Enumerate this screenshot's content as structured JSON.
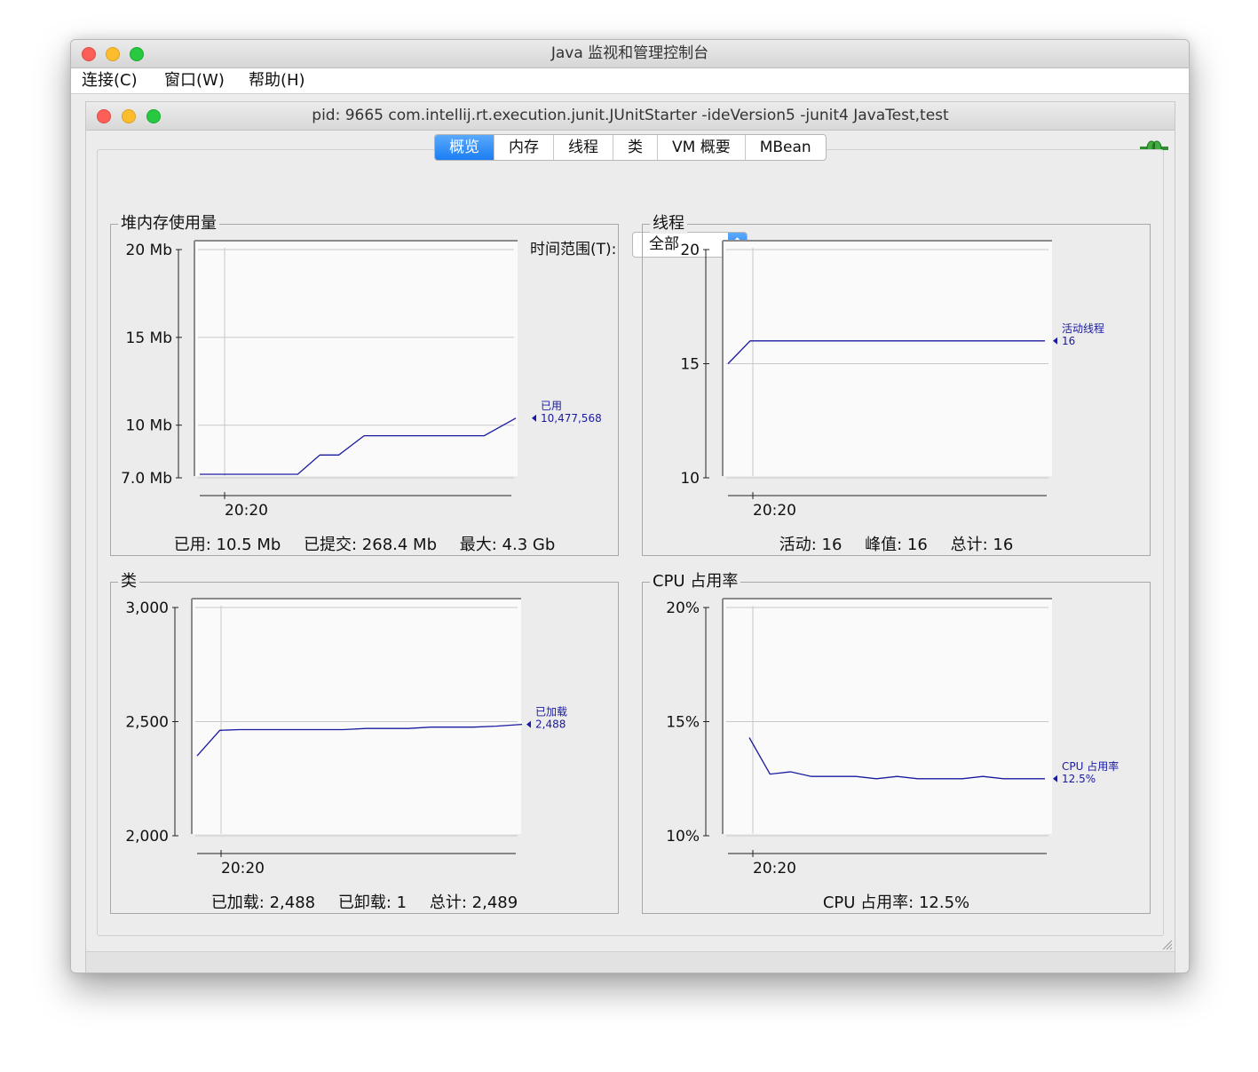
{
  "outer_window": {
    "title": "Java 监视和管理控制台"
  },
  "menu": [
    "连接(C)",
    "窗口(W)",
    "帮助(H)"
  ],
  "inner_window": {
    "title": "pid: 9665 com.intellij.rt.execution.junit.JUnitStarter -ideVersion5 -junit4 JavaTest,test"
  },
  "tabs": [
    {
      "label": "概览",
      "active": true
    },
    {
      "label": "内存",
      "active": false
    },
    {
      "label": "线程",
      "active": false
    },
    {
      "label": "类",
      "active": false
    },
    {
      "label": "VM 概要",
      "active": false
    },
    {
      "label": "MBean",
      "active": false
    }
  ],
  "time_range": {
    "label": "时间范围(T):",
    "value": "全部"
  },
  "icons": {
    "connection": "plug-connected-icon"
  },
  "colors": {
    "series": "#1a1aa0",
    "accent": "#1b7ef3"
  },
  "panels": {
    "heap": {
      "title": "堆内存使用量",
      "summary": [
        "已用: 10.5 Mb",
        "已提交: 268.4 Mb",
        "最大: 4.3 Gb"
      ],
      "chart_data": {
        "type": "line",
        "yticks": [
          {
            "label": "20 Mb",
            "value": 20
          },
          {
            "label": "15 Mb",
            "value": 15
          },
          {
            "label": "10 Mb",
            "value": 10
          },
          {
            "label": "7.0 Mb",
            "value": 7
          }
        ],
        "ylim": [
          7,
          20
        ],
        "xtick": "20:20",
        "series": [
          {
            "name": "已用",
            "value_label": "10,477,568",
            "x": [
              0,
              0.31,
              0.38,
              0.44,
              0.52,
              0.9,
              1.0
            ],
            "y": [
              7.2,
              7.2,
              8.3,
              8.3,
              9.4,
              9.4,
              10.4
            ]
          }
        ]
      }
    },
    "threads": {
      "title": "线程",
      "summary": [
        "活动: 16",
        "峰值: 16",
        "总计: 16"
      ],
      "chart_data": {
        "type": "line",
        "yticks": [
          {
            "label": "20",
            "value": 20
          },
          {
            "label": "15",
            "value": 15
          },
          {
            "label": "10",
            "value": 10
          }
        ],
        "ylim": [
          10,
          20
        ],
        "xtick": "20:20",
        "series": [
          {
            "name": "活动线程",
            "value_label": "16",
            "x": [
              0,
              0.07,
              1.0
            ],
            "y": [
              15.0,
              16.0,
              16.0
            ]
          }
        ]
      }
    },
    "classes": {
      "title": "类",
      "summary": [
        "已加载: 2,488",
        "已卸载: 1",
        "总计: 2,489"
      ],
      "chart_data": {
        "type": "line",
        "yticks": [
          {
            "label": "3,000",
            "value": 3000
          },
          {
            "label": "2,500",
            "value": 2500
          },
          {
            "label": "2,000",
            "value": 2000
          }
        ],
        "ylim": [
          2000,
          3000
        ],
        "xtick": "20:20",
        "series": [
          {
            "name": "已加载",
            "value_label": "2,488",
            "x": [
              0,
              0.07,
              0.13,
              0.45,
              0.52,
              0.65,
              0.72,
              0.85,
              0.92,
              1.0
            ],
            "y": [
              2350,
              2462,
              2465,
              2465,
              2470,
              2470,
              2476,
              2476,
              2480,
              2488
            ]
          }
        ]
      }
    },
    "cpu": {
      "title": "CPU 占用率",
      "summary": [
        "CPU 占用率: 12.5%"
      ],
      "chart_data": {
        "type": "line",
        "yticks": [
          {
            "label": "20%",
            "value": 20
          },
          {
            "label": "15%",
            "value": 15
          },
          {
            "label": "10%",
            "value": 10
          }
        ],
        "ylim": [
          10,
          20
        ],
        "xtick": "20:20",
        "series": [
          {
            "name": "CPU 占用率",
            "value_label": "12.5%",
            "x": [
              0,
              0.07,
              0.14,
              0.21,
              0.28,
              0.36,
              0.43,
              0.5,
              0.57,
              0.64,
              0.72,
              0.79,
              0.86,
              0.93,
              1.0
            ],
            "y": [
              14.3,
              12.7,
              12.8,
              12.6,
              12.6,
              12.6,
              12.5,
              12.6,
              12.5,
              12.5,
              12.5,
              12.6,
              12.5,
              12.5,
              12.5
            ]
          }
        ]
      }
    }
  }
}
